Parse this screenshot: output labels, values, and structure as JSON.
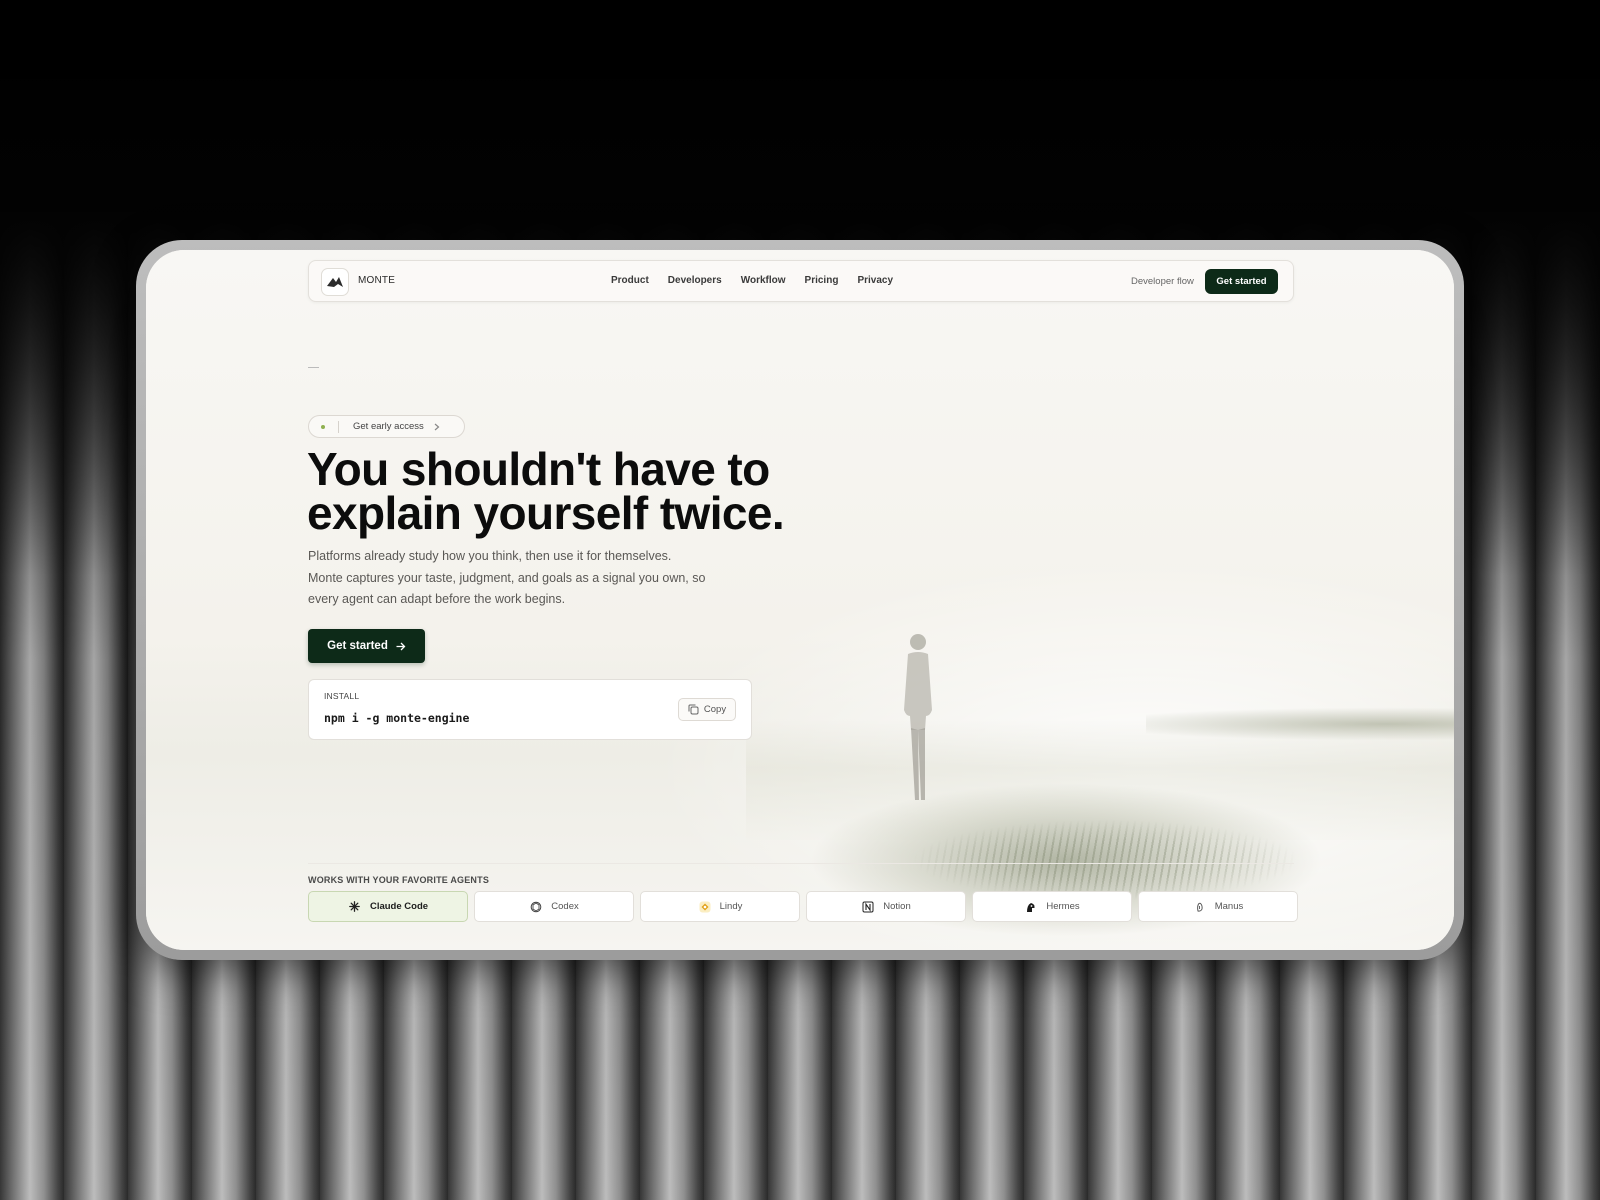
{
  "brand": {
    "name": "MONTE",
    "logo_icon": "monte-logo-icon"
  },
  "nav": {
    "links": [
      "Product",
      "Developers",
      "Workflow",
      "Pricing",
      "Privacy"
    ],
    "developer_flow": "Developer flow",
    "cta": "Get started"
  },
  "hero": {
    "badge": "Get early access",
    "headline_line1": "You shouldn't have to",
    "headline_line2": "explain yourself twice.",
    "sub_line1": "Platforms already study how you think, then use it for themselves.",
    "sub_line2": "Monte captures your taste, judgment, and goals as a signal you own, so",
    "sub_line3": "every agent can adapt before the work begins.",
    "cta": "Get started",
    "cta_icon": "arrow-right-icon"
  },
  "install": {
    "label": "INSTALL",
    "command": "npm i -g monte-engine",
    "copy_label": "Copy",
    "copy_icon": "copy-icon"
  },
  "agents": {
    "label": "WORKS WITH YOUR FAVORITE AGENTS",
    "items": [
      {
        "name": "Claude Code",
        "icon": "claude-icon",
        "active": true
      },
      {
        "name": "Codex",
        "icon": "openai-icon",
        "active": false
      },
      {
        "name": "Lindy",
        "icon": "lindy-icon",
        "active": false
      },
      {
        "name": "Notion",
        "icon": "notion-icon",
        "active": false
      },
      {
        "name": "Hermes",
        "icon": "hermes-icon",
        "active": false
      },
      {
        "name": "Manus",
        "icon": "manus-icon",
        "active": false
      }
    ]
  },
  "colors": {
    "accent": "#0d2a18",
    "active_tab": "#eef4e4",
    "badge_dot": "#8fb050"
  }
}
